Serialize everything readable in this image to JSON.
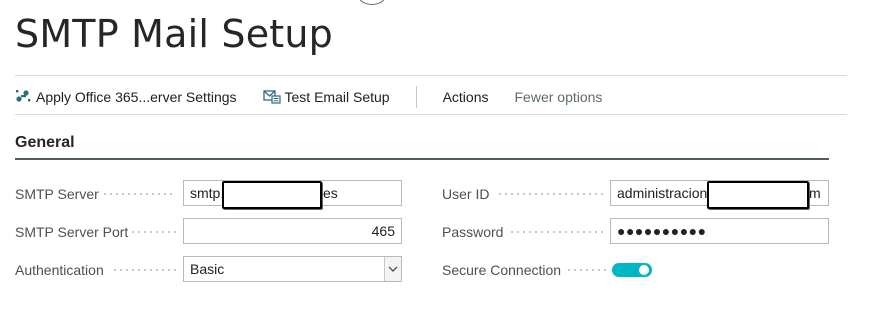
{
  "page": {
    "title": "SMTP Mail Setup"
  },
  "actions": {
    "apply_office": {
      "label": "Apply Office 365...erver Settings",
      "icon": "puzzle-icon"
    },
    "test_email": {
      "label": "Test Email Setup",
      "icon": "test-email-icon"
    },
    "actions_menu": "Actions",
    "fewer_options": "Fewer options"
  },
  "section": {
    "title": "General"
  },
  "fields": {
    "smtp_server": {
      "label": "SMTP Server",
      "value_prefix": "smtp.",
      "value_suffix": "es"
    },
    "smtp_port": {
      "label": "SMTP Server Port",
      "value": "465"
    },
    "authentication": {
      "label": "Authentication",
      "value": "Basic"
    },
    "user_id": {
      "label": "User ID",
      "value_prefix": "administracion",
      "value_suffix": "m"
    },
    "password": {
      "label": "Password",
      "value": "●●●●●●●●●●"
    },
    "secure_connection": {
      "label": "Secure Connection",
      "value": "on"
    }
  },
  "colors": {
    "accent": "#00b7c3",
    "title_text": "#262626",
    "label_text": "#505050"
  }
}
